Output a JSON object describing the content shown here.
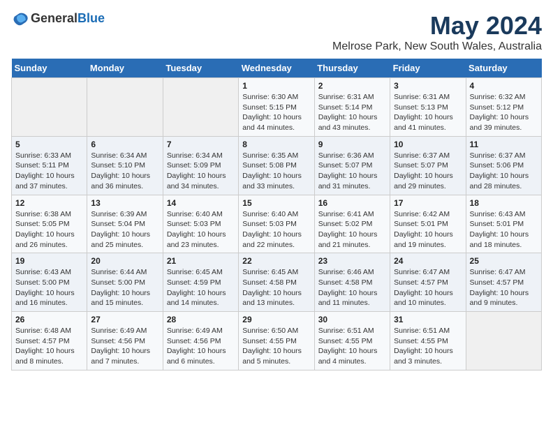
{
  "header": {
    "logo_general": "General",
    "logo_blue": "Blue",
    "title": "May 2024",
    "subtitle": "Melrose Park, New South Wales, Australia"
  },
  "days_of_week": [
    "Sunday",
    "Monday",
    "Tuesday",
    "Wednesday",
    "Thursday",
    "Friday",
    "Saturday"
  ],
  "weeks": [
    {
      "days": [
        {
          "num": "",
          "detail": ""
        },
        {
          "num": "",
          "detail": ""
        },
        {
          "num": "",
          "detail": ""
        },
        {
          "num": "1",
          "detail": "Sunrise: 6:30 AM\nSunset: 5:15 PM\nDaylight: 10 hours\nand 44 minutes."
        },
        {
          "num": "2",
          "detail": "Sunrise: 6:31 AM\nSunset: 5:14 PM\nDaylight: 10 hours\nand 43 minutes."
        },
        {
          "num": "3",
          "detail": "Sunrise: 6:31 AM\nSunset: 5:13 PM\nDaylight: 10 hours\nand 41 minutes."
        },
        {
          "num": "4",
          "detail": "Sunrise: 6:32 AM\nSunset: 5:12 PM\nDaylight: 10 hours\nand 39 minutes."
        }
      ]
    },
    {
      "days": [
        {
          "num": "5",
          "detail": "Sunrise: 6:33 AM\nSunset: 5:11 PM\nDaylight: 10 hours\nand 37 minutes."
        },
        {
          "num": "6",
          "detail": "Sunrise: 6:34 AM\nSunset: 5:10 PM\nDaylight: 10 hours\nand 36 minutes."
        },
        {
          "num": "7",
          "detail": "Sunrise: 6:34 AM\nSunset: 5:09 PM\nDaylight: 10 hours\nand 34 minutes."
        },
        {
          "num": "8",
          "detail": "Sunrise: 6:35 AM\nSunset: 5:08 PM\nDaylight: 10 hours\nand 33 minutes."
        },
        {
          "num": "9",
          "detail": "Sunrise: 6:36 AM\nSunset: 5:07 PM\nDaylight: 10 hours\nand 31 minutes."
        },
        {
          "num": "10",
          "detail": "Sunrise: 6:37 AM\nSunset: 5:07 PM\nDaylight: 10 hours\nand 29 minutes."
        },
        {
          "num": "11",
          "detail": "Sunrise: 6:37 AM\nSunset: 5:06 PM\nDaylight: 10 hours\nand 28 minutes."
        }
      ]
    },
    {
      "days": [
        {
          "num": "12",
          "detail": "Sunrise: 6:38 AM\nSunset: 5:05 PM\nDaylight: 10 hours\nand 26 minutes."
        },
        {
          "num": "13",
          "detail": "Sunrise: 6:39 AM\nSunset: 5:04 PM\nDaylight: 10 hours\nand 25 minutes."
        },
        {
          "num": "14",
          "detail": "Sunrise: 6:40 AM\nSunset: 5:03 PM\nDaylight: 10 hours\nand 23 minutes."
        },
        {
          "num": "15",
          "detail": "Sunrise: 6:40 AM\nSunset: 5:03 PM\nDaylight: 10 hours\nand 22 minutes."
        },
        {
          "num": "16",
          "detail": "Sunrise: 6:41 AM\nSunset: 5:02 PM\nDaylight: 10 hours\nand 21 minutes."
        },
        {
          "num": "17",
          "detail": "Sunrise: 6:42 AM\nSunset: 5:01 PM\nDaylight: 10 hours\nand 19 minutes."
        },
        {
          "num": "18",
          "detail": "Sunrise: 6:43 AM\nSunset: 5:01 PM\nDaylight: 10 hours\nand 18 minutes."
        }
      ]
    },
    {
      "days": [
        {
          "num": "19",
          "detail": "Sunrise: 6:43 AM\nSunset: 5:00 PM\nDaylight: 10 hours\nand 16 minutes."
        },
        {
          "num": "20",
          "detail": "Sunrise: 6:44 AM\nSunset: 5:00 PM\nDaylight: 10 hours\nand 15 minutes."
        },
        {
          "num": "21",
          "detail": "Sunrise: 6:45 AM\nSunset: 4:59 PM\nDaylight: 10 hours\nand 14 minutes."
        },
        {
          "num": "22",
          "detail": "Sunrise: 6:45 AM\nSunset: 4:58 PM\nDaylight: 10 hours\nand 13 minutes."
        },
        {
          "num": "23",
          "detail": "Sunrise: 6:46 AM\nSunset: 4:58 PM\nDaylight: 10 hours\nand 11 minutes."
        },
        {
          "num": "24",
          "detail": "Sunrise: 6:47 AM\nSunset: 4:57 PM\nDaylight: 10 hours\nand 10 minutes."
        },
        {
          "num": "25",
          "detail": "Sunrise: 6:47 AM\nSunset: 4:57 PM\nDaylight: 10 hours\nand 9 minutes."
        }
      ]
    },
    {
      "days": [
        {
          "num": "26",
          "detail": "Sunrise: 6:48 AM\nSunset: 4:57 PM\nDaylight: 10 hours\nand 8 minutes."
        },
        {
          "num": "27",
          "detail": "Sunrise: 6:49 AM\nSunset: 4:56 PM\nDaylight: 10 hours\nand 7 minutes."
        },
        {
          "num": "28",
          "detail": "Sunrise: 6:49 AM\nSunset: 4:56 PM\nDaylight: 10 hours\nand 6 minutes."
        },
        {
          "num": "29",
          "detail": "Sunrise: 6:50 AM\nSunset: 4:55 PM\nDaylight: 10 hours\nand 5 minutes."
        },
        {
          "num": "30",
          "detail": "Sunrise: 6:51 AM\nSunset: 4:55 PM\nDaylight: 10 hours\nand 4 minutes."
        },
        {
          "num": "31",
          "detail": "Sunrise: 6:51 AM\nSunset: 4:55 PM\nDaylight: 10 hours\nand 3 minutes."
        },
        {
          "num": "",
          "detail": ""
        }
      ]
    }
  ]
}
